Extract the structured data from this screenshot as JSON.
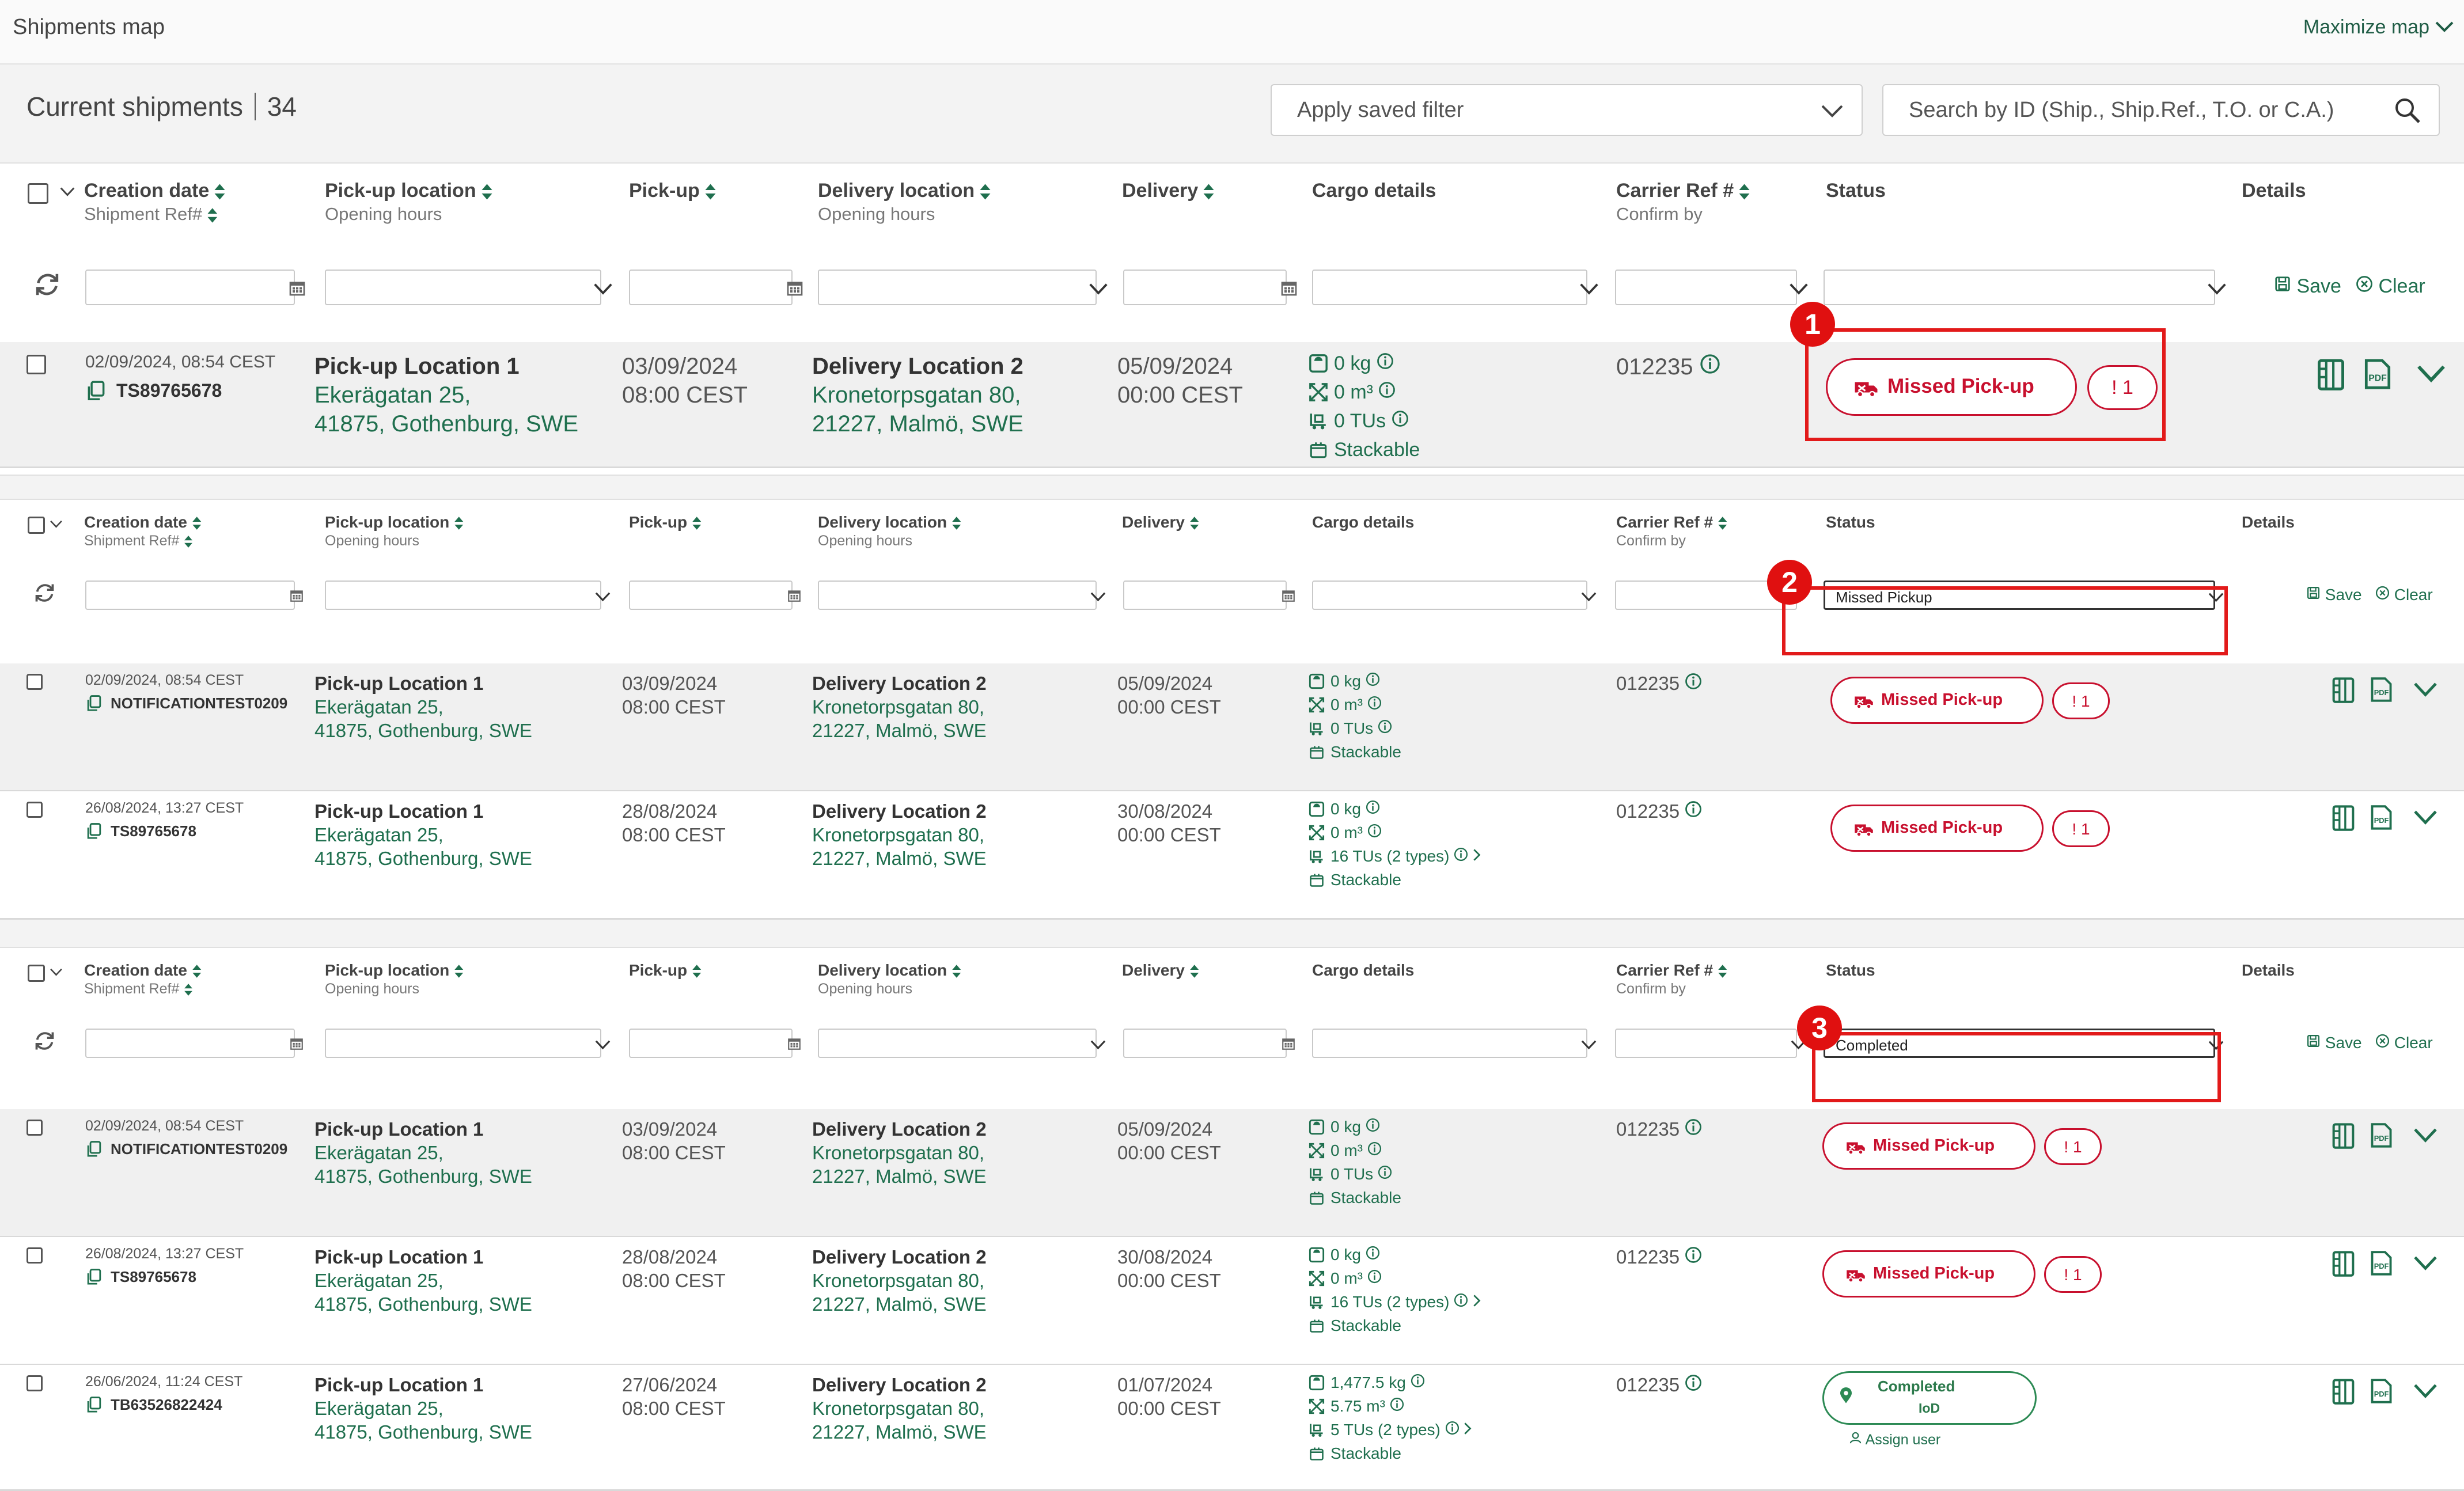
{
  "window": {
    "title": "Shipments map",
    "maximize_label": "Maximize map"
  },
  "header": {
    "title": "Current shipments",
    "count": "34"
  },
  "saved_filter": {
    "placeholder": "Apply saved filter"
  },
  "search": {
    "placeholder": "Search by ID (Ship., Ship.Ref., T.O. or C.A.)"
  },
  "columns": {
    "creation_date": "Creation date",
    "shipment_ref": "Shipment Ref#",
    "pickup_location": "Pick-up location",
    "opening_hours": "Opening hours",
    "pickup": "Pick-up",
    "delivery_location": "Delivery location",
    "delivery": "Delivery",
    "cargo_details": "Cargo details",
    "carrier_ref": "Carrier Ref #",
    "confirm_by": "Confirm by",
    "status": "Status",
    "details": "Details"
  },
  "filter_actions": {
    "save": "Save",
    "clear": "Clear"
  },
  "panels": [
    {
      "status_filter": "",
      "callout": "1"
    },
    {
      "status_filter": "Missed Pickup",
      "callout": "2"
    },
    {
      "status_filter": "Completed",
      "callout": "3"
    }
  ],
  "rows": {
    "r1": {
      "created": "02/09/2024, 08:54 CEST",
      "ref": "TS89765678",
      "pu_name": "Pick-up Location 1",
      "pu_addr1": "Ekerägatan 25,",
      "pu_addr2": "41875, Gothenburg, SWE",
      "pu_date": "03/09/2024",
      "pu_time": "08:00 CEST",
      "del_name": "Delivery Location 2",
      "del_addr1": "Kronetorpsgatan 80,",
      "del_addr2": "21227, Malmö, SWE",
      "del_date": "05/09/2024",
      "del_time": "00:00 CEST",
      "weight": "0 kg",
      "volume": "0 m³",
      "tus": "0 TUs",
      "stack": "Stackable",
      "carrier": "012235",
      "status": "Missed Pick-up",
      "alert": "! 1"
    },
    "r2": {
      "created": "02/09/2024, 08:54 CEST",
      "ref": "NOTIFICATIONTEST0209",
      "pu_name": "Pick-up Location 1",
      "pu_addr1": "Ekerägatan 25,",
      "pu_addr2": "41875, Gothenburg, SWE",
      "pu_date": "03/09/2024",
      "pu_time": "08:00 CEST",
      "del_name": "Delivery Location 2",
      "del_addr1": "Kronetorpsgatan 80,",
      "del_addr2": "21227, Malmö, SWE",
      "del_date": "05/09/2024",
      "del_time": "00:00 CEST",
      "weight": "0 kg",
      "volume": "0 m³",
      "tus": "0 TUs",
      "stack": "Stackable",
      "carrier": "012235",
      "status": "Missed Pick-up",
      "alert": "! 1"
    },
    "r3": {
      "created": "26/08/2024, 13:27 CEST",
      "ref": "TS89765678",
      "pu_name": "Pick-up Location 1",
      "pu_addr1": "Ekerägatan 25,",
      "pu_addr2": "41875, Gothenburg, SWE",
      "pu_date": "28/08/2024",
      "pu_time": "08:00 CEST",
      "del_name": "Delivery Location 2",
      "del_addr1": "Kronetorpsgatan 80,",
      "del_addr2": "21227, Malmö, SWE",
      "del_date": "30/08/2024",
      "del_time": "00:00 CEST",
      "weight": "0 kg",
      "volume": "0 m³",
      "tus": "16 TUs (2 types)",
      "stack": "Stackable",
      "carrier": "012235",
      "status": "Missed Pick-up",
      "alert": "! 1"
    },
    "r4": {
      "created": "02/09/2024, 08:54 CEST",
      "ref": "NOTIFICATIONTEST0209",
      "pu_name": "Pick-up Location 1",
      "pu_addr1": "Ekerägatan 25,",
      "pu_addr2": "41875, Gothenburg, SWE",
      "pu_date": "03/09/2024",
      "pu_time": "08:00 CEST",
      "del_name": "Delivery Location 2",
      "del_addr1": "Kronetorpsgatan 80,",
      "del_addr2": "21227, Malmö, SWE",
      "del_date": "05/09/2024",
      "del_time": "00:00 CEST",
      "weight": "0 kg",
      "volume": "0 m³",
      "tus": "0 TUs",
      "stack": "Stackable",
      "carrier": "012235",
      "status": "Missed Pick-up",
      "alert": "! 1"
    },
    "r5": {
      "created": "26/08/2024, 13:27 CEST",
      "ref": "TS89765678",
      "pu_name": "Pick-up Location 1",
      "pu_addr1": "Ekerägatan 25,",
      "pu_addr2": "41875, Gothenburg, SWE",
      "pu_date": "28/08/2024",
      "pu_time": "08:00 CEST",
      "del_name": "Delivery Location 2",
      "del_addr1": "Kronetorpsgatan 80,",
      "del_addr2": "21227, Malmö, SWE",
      "del_date": "30/08/2024",
      "del_time": "00:00 CEST",
      "weight": "0 kg",
      "volume": "0 m³",
      "tus": "16 TUs (2 types)",
      "stack": "Stackable",
      "carrier": "012235",
      "status": "Missed Pick-up",
      "alert": "! 1"
    },
    "r6": {
      "created": "26/06/2024, 11:24 CEST",
      "ref": "TB63526822424",
      "pu_name": "Pick-up Location 1",
      "pu_addr1": "Ekerägatan 25,",
      "pu_addr2": "41875, Gothenburg, SWE",
      "pu_date": "27/06/2024",
      "pu_time": "08:00 CEST",
      "del_name": "Delivery Location 2",
      "del_addr1": "Kronetorpsgatan 80,",
      "del_addr2": "21227, Malmö, SWE",
      "del_date": "01/07/2024",
      "del_time": "00:00 CEST",
      "weight": "1,477.5 kg",
      "volume": "5.75 m³",
      "tus": "5 TUs (2 types)",
      "stack": "Stackable",
      "carrier": "012235",
      "status": "Completed",
      "status_sub": "IoD",
      "assign": "Assign user"
    }
  },
  "icons": [
    "chevron-down-icon",
    "search-icon",
    "sort-icon",
    "refresh-icon",
    "calendar-icon",
    "copy-icon",
    "info-icon",
    "weight-icon",
    "volume-icon",
    "forklift-icon",
    "box-icon",
    "truck-icon",
    "location-pin-icon",
    "user-icon",
    "document-icon",
    "pdf-icon",
    "save-icon",
    "clear-icon"
  ],
  "colors": {
    "brand_green": "#1f6f4e",
    "alert_red": "#c8102e",
    "callout_red": "#e21a1a",
    "completed_green": "#2c8a54"
  }
}
